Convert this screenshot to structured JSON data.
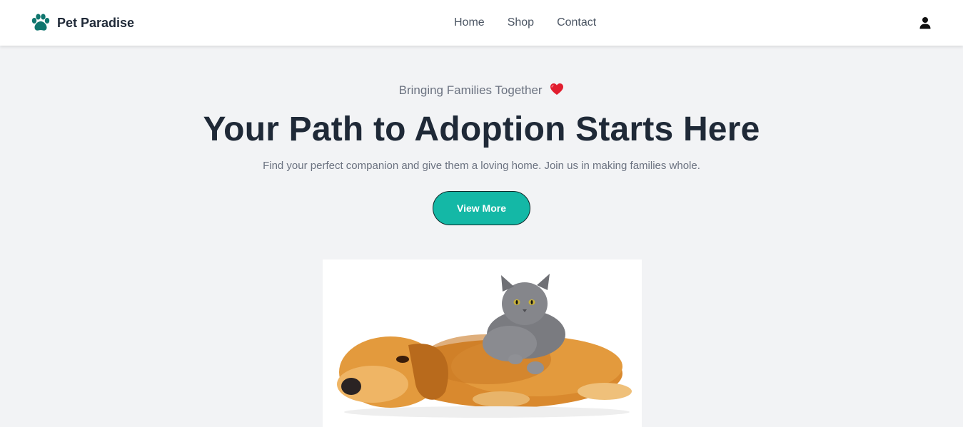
{
  "header": {
    "brand_name": "Pet Paradise",
    "brand_icon": "paw-icon",
    "nav": [
      {
        "label": "Home"
      },
      {
        "label": "Shop"
      },
      {
        "label": "Contact"
      }
    ],
    "user_icon": "user-icon"
  },
  "hero": {
    "tagline": "Bringing Families Together",
    "tagline_icon": "heart-icon",
    "headline": "Your Path to Adoption Starts Here",
    "subtext": "Find your perfect companion and give them a loving home. Join us in making families whole.",
    "cta_label": "View More",
    "image_icon": "dog-and-cat-image"
  },
  "colors": {
    "brand_teal": "#0f766e",
    "cta": "#14b8a6",
    "background": "#f2f3f5",
    "heading": "#1f2937",
    "heart": "#e11d2e"
  }
}
